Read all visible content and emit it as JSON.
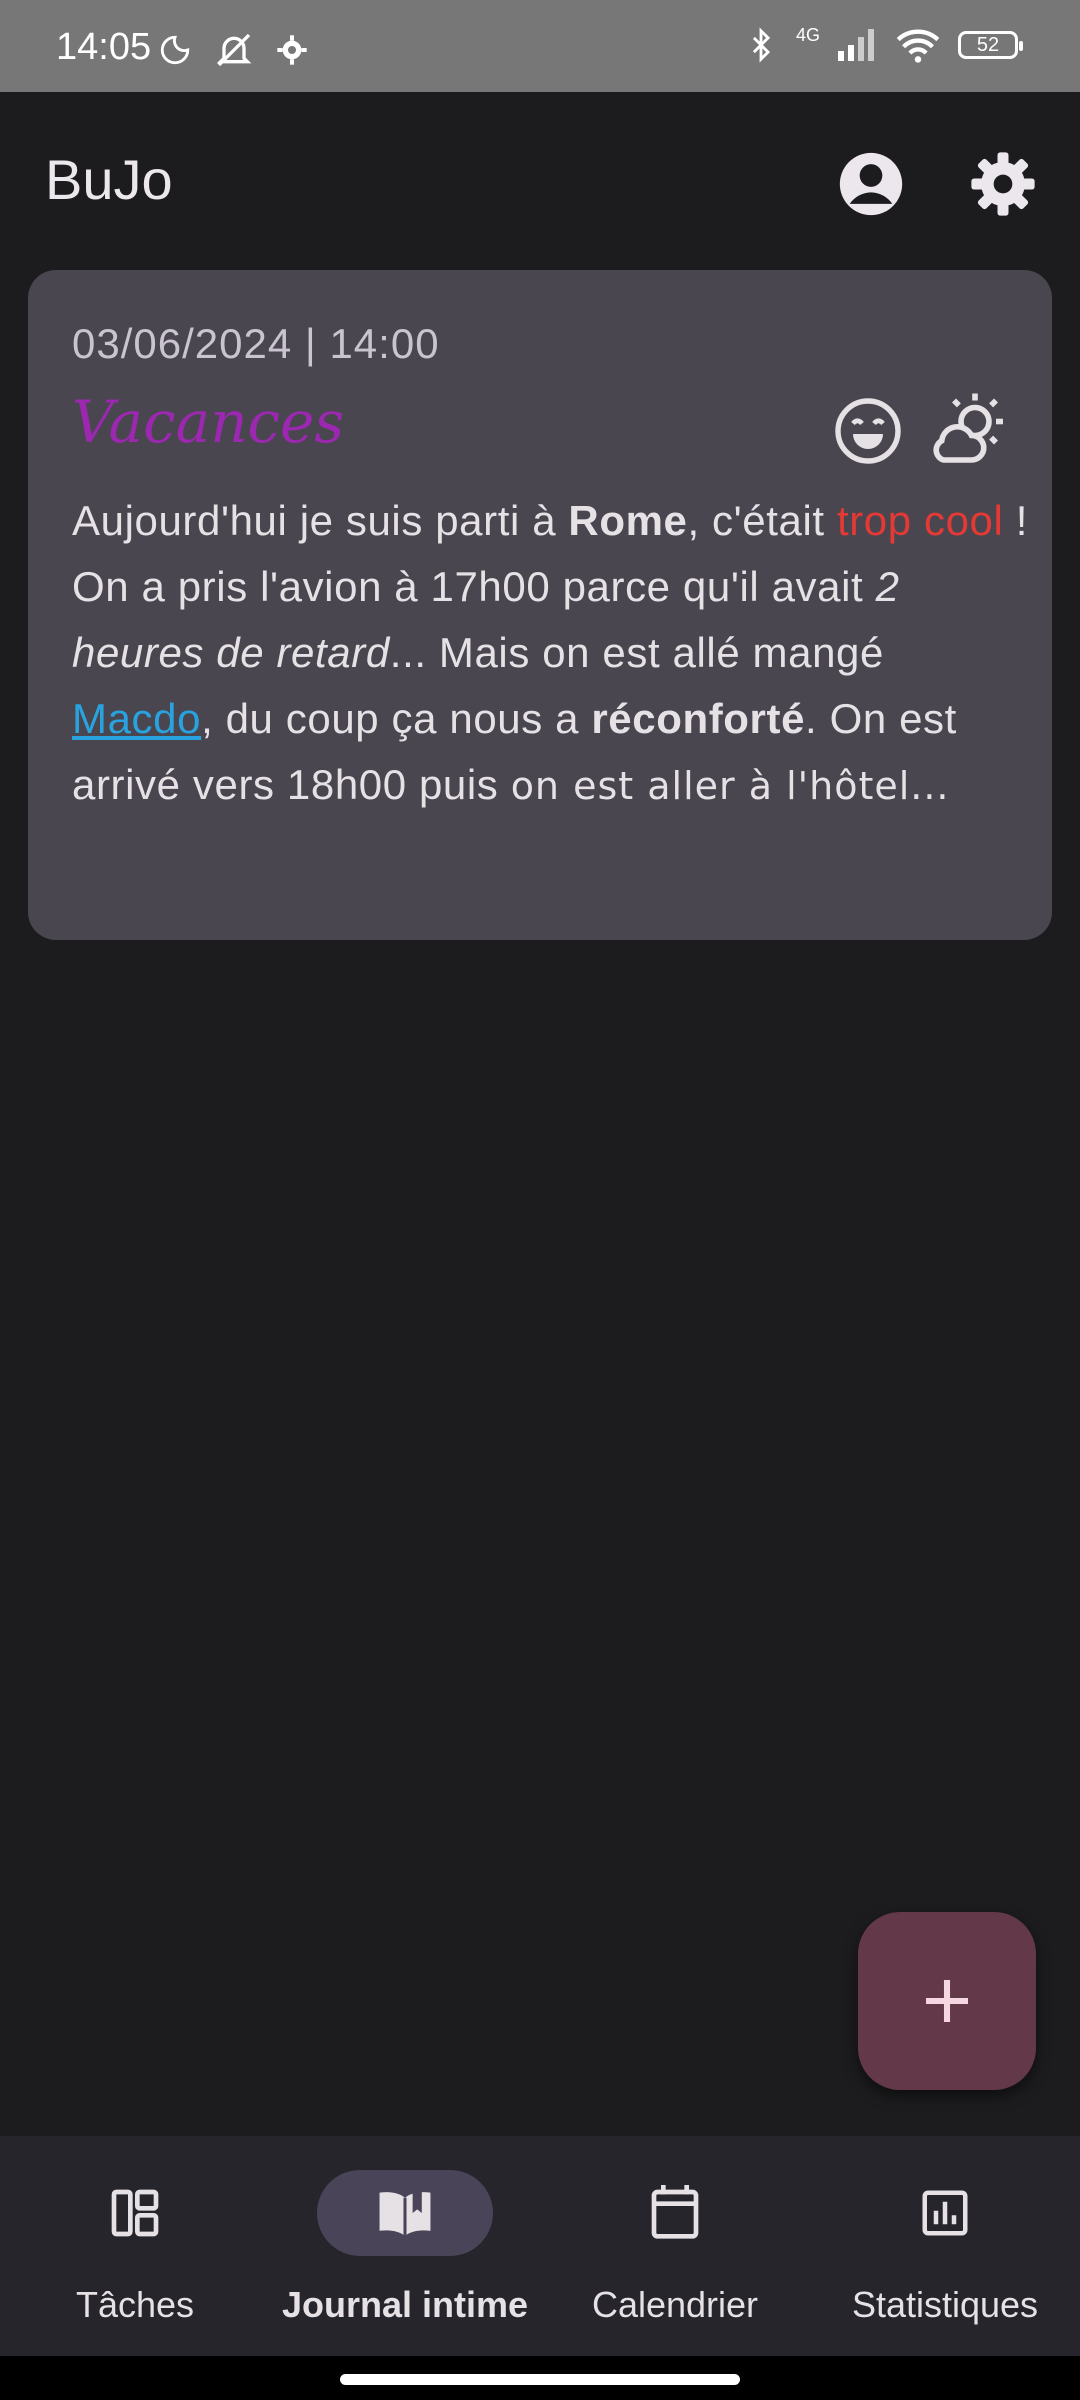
{
  "status_bar": {
    "time": "14:05",
    "network": "4G",
    "battery": "52",
    "icons_left": [
      "moon-icon",
      "alarm-off-icon",
      "gear-icon"
    ],
    "icons_right": [
      "bluetooth-icon",
      "signal-icon",
      "wifi-icon",
      "battery-icon"
    ]
  },
  "app_bar": {
    "title": "BuJo",
    "actions": [
      "account-icon",
      "settings-icon"
    ]
  },
  "entry": {
    "date": "03/06/2024 | 14:00",
    "title": "Vacances",
    "title_color": "#9c27b0",
    "mood_icon": "happy-face-icon",
    "weather_icon": "partly-cloudy-icon",
    "body": {
      "p1": "Aujourd'hui je suis parti à ",
      "bold1": "Rome",
      "p2": ", c'était ",
      "red1": "trop cool",
      "p3": " ! On a pris l'avion à 17h00 parce qu'il avait ",
      "italic1": "2 heures de retard",
      "p4": "... Mais on est allé mangé ",
      "link1": "Macdo",
      "p5": ", du coup ça nous a ",
      "bold2": "réconforté",
      "p6": ". On est arrivé vers 18h00 puis ",
      "hand1": "on est aller à l'hôtel..."
    },
    "colors": {
      "red": "#e53935",
      "link": "#29a3e0"
    }
  },
  "fab": {
    "icon": "plus-icon",
    "color": "#63394a"
  },
  "bottom_nav": {
    "items": [
      {
        "label": "Tâches",
        "icon": "dashboard-icon",
        "active": false
      },
      {
        "label": "Journal intime",
        "icon": "open-book-icon",
        "active": true
      },
      {
        "label": "Calendrier",
        "icon": "calendar-icon",
        "active": false
      },
      {
        "label": "Statistiques",
        "icon": "bar-chart-icon",
        "active": false
      }
    ]
  }
}
